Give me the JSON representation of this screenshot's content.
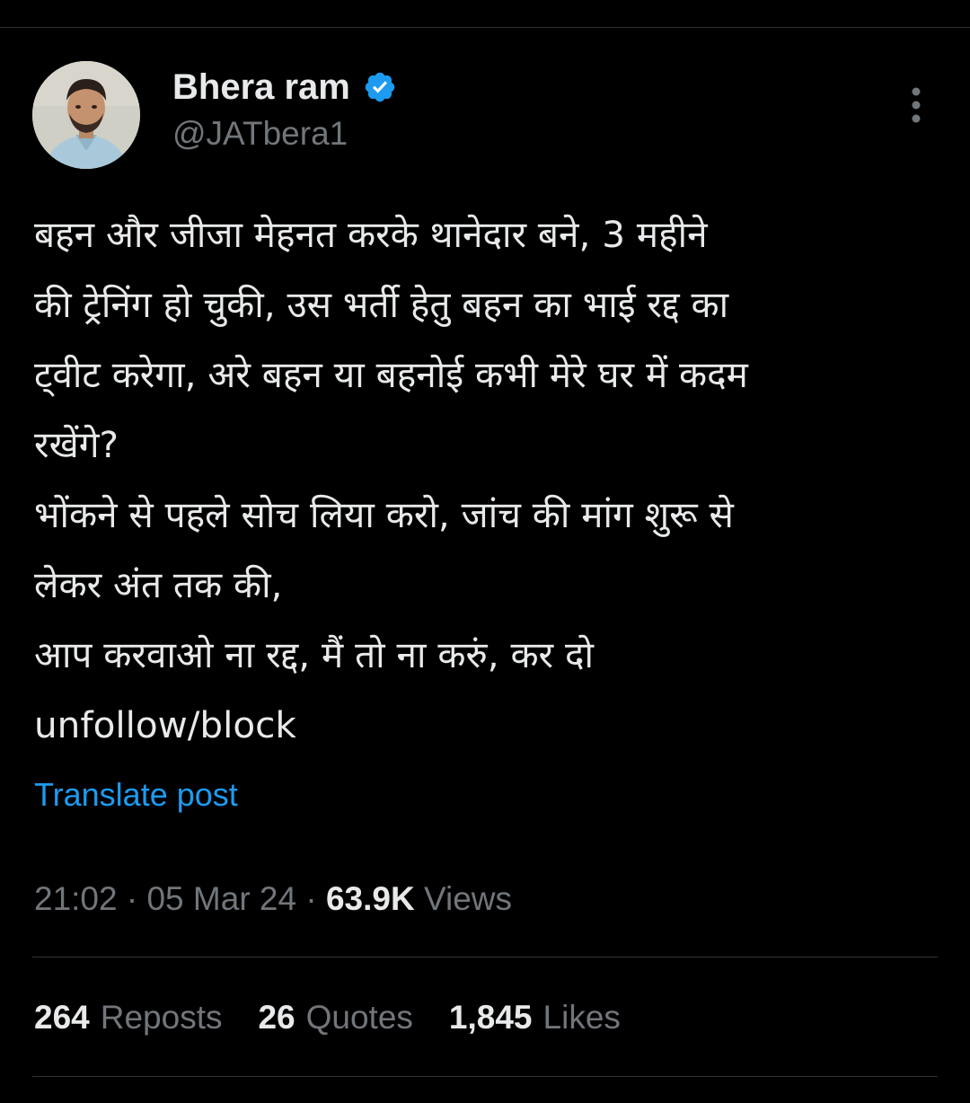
{
  "author": {
    "name": "Bhera ram",
    "handle": "@JATbera1",
    "verified": true,
    "verified_color": "#1d9bf0"
  },
  "post": {
    "text": "बहन और जीजा मेहनत करके थानेदार बने, 3 महीने\nकी ट्रेनिंग हो चुकी, उस भर्ती हेतु बहन का भाई रद्द का\nट्वीट करेगा, अरे बहन या बहनोई कभी मेरे घर में कदम\nरखेंगे?\nभोंकने से पहले सोच लिया करो, जांच की मांग शुरू से\nलेकर अंत तक की,\nआप करवाओ ना रद्द, मैं तो ना करुं, कर दो\nunfollow/block",
    "translate_label": "Translate post"
  },
  "meta": {
    "time": "21:02",
    "separator": " · ",
    "date": "05 Mar 24",
    "views_count": "63.9K",
    "views_label": "Views"
  },
  "stats": [
    {
      "count": "264",
      "label": "Reposts"
    },
    {
      "count": "26",
      "label": "Quotes"
    },
    {
      "count": "1,845",
      "label": "Likes"
    }
  ],
  "icons": {
    "more": "more-vertical-icon",
    "verified": "verified-badge-icon"
  },
  "colors": {
    "background": "#000000",
    "text_primary": "#e7e9ea",
    "text_secondary": "#71767b",
    "link": "#1d9bf0",
    "divider": "#2f3336"
  }
}
